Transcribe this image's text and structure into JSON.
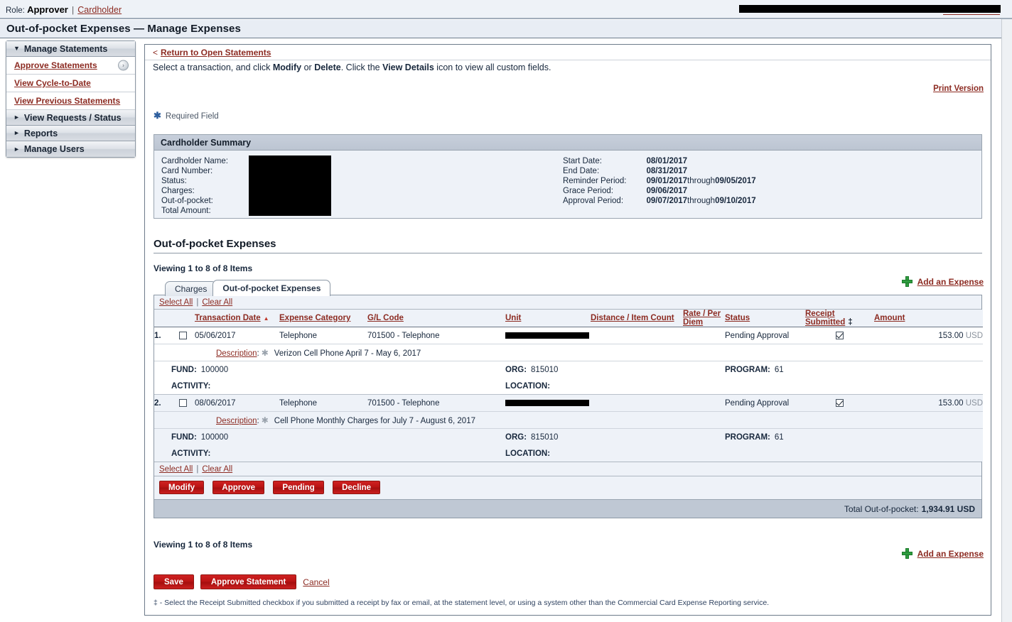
{
  "topbar": {
    "role_label": "Role:",
    "role_value": "Approver",
    "separator": "|",
    "role_link": "Cardholder"
  },
  "page_title": "Out-of-pocket Expenses — Manage Expenses",
  "sidebar": {
    "groups": [
      {
        "label": "Manage Statements",
        "caret": "▼",
        "expanded": true,
        "items": [
          {
            "label": "Approve Statements",
            "selected": true,
            "go_icon": "›"
          },
          {
            "label": "View Cycle-to-Date",
            "selected": false
          },
          {
            "label": "View Previous Statements",
            "selected": false
          }
        ]
      },
      {
        "label": "View Requests / Status",
        "caret": "►",
        "expanded": false,
        "items": []
      },
      {
        "label": "Reports",
        "caret": "►",
        "expanded": false,
        "items": []
      },
      {
        "label": "Manage Users",
        "caret": "►",
        "expanded": false,
        "items": []
      }
    ]
  },
  "breadcrumb": {
    "prefix": "<",
    "link": "Return to Open Statements"
  },
  "instructions": {
    "part1": "Select a transaction, and click ",
    "bold1": "Modify",
    "part2": " or ",
    "bold2": "Delete",
    "part3": ". Click the ",
    "bold3": "View Details",
    "part4": " icon to view all custom fields."
  },
  "print_version": "Print Version",
  "required_field": "Required Field",
  "summary": {
    "title": "Cardholder Summary",
    "left_labels": [
      "Cardholder Name:",
      "Card Number:",
      "Status:",
      "Charges:",
      "Out-of-pocket:",
      "Total Amount:"
    ],
    "right_rows": [
      {
        "label": "Start Date:",
        "value": "08/01/2017",
        "through": "",
        "value2": ""
      },
      {
        "label": "End Date:",
        "value": "08/31/2017",
        "through": "",
        "value2": ""
      },
      {
        "label": "Reminder Period:",
        "value": "09/01/2017",
        "through": "through",
        "value2": "09/05/2017"
      },
      {
        "label": "Grace Period:",
        "value": "09/06/2017",
        "through": "",
        "value2": ""
      },
      {
        "label": "Approval Period:",
        "value": "09/07/2017",
        "through": "through",
        "value2": "09/10/2017"
      }
    ]
  },
  "section": {
    "title": "Out-of-pocket Expenses",
    "viewing_top": "Viewing 1 to 8 of 8 Items",
    "viewing_bottom": "Viewing 1 to 8 of 8 Items",
    "add_expense": "Add an Expense"
  },
  "tabs": [
    {
      "label": "Charges",
      "active": false
    },
    {
      "label": "Out-of-pocket Expenses",
      "active": true
    }
  ],
  "select_controls": {
    "select_all": "Select All",
    "separator": "|",
    "clear_all": "Clear All"
  },
  "table": {
    "headers": [
      "Transaction Date",
      "Expense Category",
      "G/L Code",
      "Unit",
      "Distance / Item Count",
      "Rate / Per Diem",
      "Status",
      "Receipt Submitted",
      "Amount"
    ],
    "sort_indicator": "▲",
    "receipt_dagger": "‡",
    "rows": [
      {
        "index": "1.",
        "checked": false,
        "transaction_date": "05/06/2017",
        "expense_category": "Telephone",
        "gl_code": "701500 - Telephone",
        "unit": "",
        "distance_item_count": "",
        "rate_per_diem": "",
        "status": "Pending Approval",
        "receipt_submitted": true,
        "amount": "153.00",
        "currency": "USD",
        "description_label": "Description",
        "description": "Verizon Cell Phone April 7 - May 6, 2017",
        "custom_fields": [
          {
            "label": "FUND:",
            "value": "100000"
          },
          {
            "label": "ORG:",
            "value": "815010"
          },
          {
            "label": "PROGRAM:",
            "value": "61"
          },
          {
            "label": "ACTIVITY:",
            "value": ""
          },
          {
            "label": "LOCATION:",
            "value": ""
          }
        ]
      },
      {
        "index": "2.",
        "checked": false,
        "transaction_date": "08/06/2017",
        "expense_category": "Telephone",
        "gl_code": "701500 - Telephone",
        "unit": "",
        "distance_item_count": "",
        "rate_per_diem": "",
        "status": "Pending Approval",
        "receipt_submitted": true,
        "amount": "153.00",
        "currency": "USD",
        "description_label": "Description",
        "description": "Cell Phone Monthly Charges for July 7 - August 6, 2017",
        "custom_fields": [
          {
            "label": "FUND:",
            "value": "100000"
          },
          {
            "label": "ORG:",
            "value": "815010"
          },
          {
            "label": "PROGRAM:",
            "value": "61"
          },
          {
            "label": "ACTIVITY:",
            "value": ""
          },
          {
            "label": "LOCATION:",
            "value": ""
          }
        ]
      }
    ]
  },
  "row_buttons": [
    {
      "label": "Modify"
    },
    {
      "label": "Approve"
    },
    {
      "label": "Pending"
    },
    {
      "label": "Decline"
    }
  ],
  "total": {
    "label": "Total Out-of-pocket:",
    "value": "1,934.91 USD"
  },
  "bottom_actions": {
    "save": "Save",
    "approve_statement": "Approve Statement",
    "cancel": "Cancel"
  },
  "footnote": "‡ - Select the Receipt Submitted checkbox if you submitted a receipt by fax or email, at the statement level, or using a system other than the Commercial Card Expense Reporting service.",
  "colors": {
    "link": "#8c2b22",
    "button_red": "#bb1414",
    "panel_blue": "#eef2f8",
    "summary_header": "#bfc8d4",
    "plus_green": "#2e9c3f"
  }
}
